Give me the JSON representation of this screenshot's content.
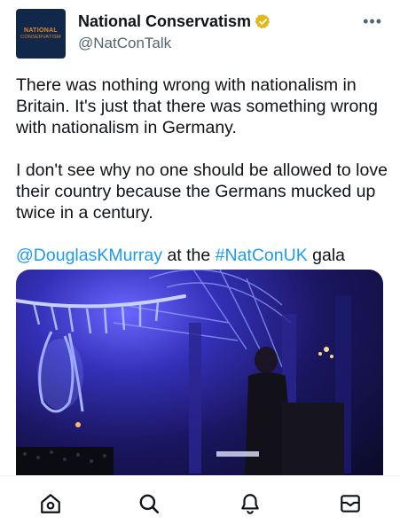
{
  "account": {
    "avatar_line1": "NATIONAL",
    "avatar_line2": "CONSERVATISM",
    "display_name": "National Conservatism",
    "handle": "@NatConTalk",
    "verified_badge_color": "#e2b719"
  },
  "tweet": {
    "paragraph1": "There was nothing wrong with nationalism in Britain. It's just that there was something wrong with nationalism in Germany.",
    "paragraph2": "I don't see why no one should be allowed to love their country because the Germans mucked up twice in a century.",
    "mention": "@DouglasKMurray",
    "middle_text": " at the ",
    "hashtag": "#NatConUK",
    "end_text": " gala"
  },
  "colors": {
    "link": "#1d9bf0",
    "secondary_text": "#536471"
  },
  "tabbar": {
    "items": [
      {
        "icon": "home-icon"
      },
      {
        "icon": "search-icon"
      },
      {
        "icon": "notifications-bell-icon"
      },
      {
        "icon": "messages-envelope-icon"
      }
    ]
  }
}
